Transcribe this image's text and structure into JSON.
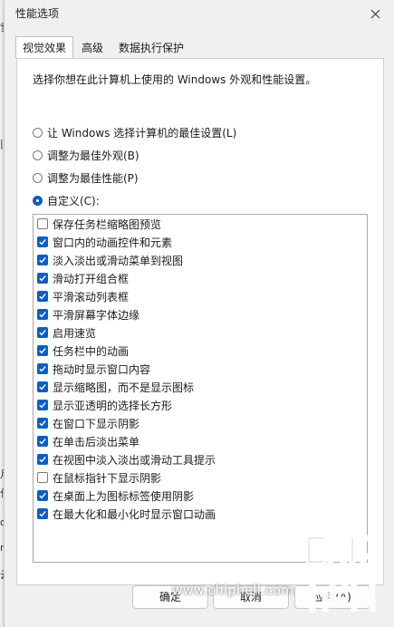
{
  "dialog": {
    "title": "性能选项",
    "close_icon": "close-icon"
  },
  "tabs": [
    {
      "label": "视觉效果",
      "active": true
    },
    {
      "label": "高级",
      "active": false
    },
    {
      "label": "数据执行保护",
      "active": false
    }
  ],
  "panel": {
    "description": "选择你想在此计算机上使用的 Windows 外观和性能设置。",
    "radios": [
      {
        "label": "让 Windows 选择计算机的最佳设置(L)",
        "checked": false
      },
      {
        "label": "调整为最佳外观(B)",
        "checked": false
      },
      {
        "label": "调整为最佳性能(P)",
        "checked": false
      },
      {
        "label": "自定义(C):",
        "checked": true
      }
    ],
    "options": [
      {
        "label": "保存任务栏缩略图预览",
        "checked": false
      },
      {
        "label": "窗口内的动画控件和元素",
        "checked": true
      },
      {
        "label": "淡入淡出或滑动菜单到视图",
        "checked": true
      },
      {
        "label": "滑动打开组合框",
        "checked": true
      },
      {
        "label": "平滑滚动列表框",
        "checked": true
      },
      {
        "label": "平滑屏幕字体边缘",
        "checked": true
      },
      {
        "label": "启用速览",
        "checked": true
      },
      {
        "label": "任务栏中的动画",
        "checked": true
      },
      {
        "label": "拖动时显示窗口内容",
        "checked": true
      },
      {
        "label": "显示缩略图，而不是显示图标",
        "checked": true
      },
      {
        "label": "显示亚透明的选择长方形",
        "checked": true
      },
      {
        "label": "在窗口下显示阴影",
        "checked": true
      },
      {
        "label": "在单击后淡出菜单",
        "checked": true
      },
      {
        "label": "在视图中淡入淡出或滑动工具提示",
        "checked": true
      },
      {
        "label": "在鼠标指针下显示阴影",
        "checked": false
      },
      {
        "label": "在桌面上为图标标签使用阴影",
        "checked": true
      },
      {
        "label": "在最大化和最小化时显示窗口动画",
        "checked": true
      }
    ]
  },
  "buttons": {
    "ok": "确定",
    "cancel": "取消",
    "apply": "应用(A)"
  },
  "watermark": "www.chiphell.com",
  "logo_text": "chiphell",
  "colors": {
    "accent": "#0a5fc2",
    "panel_bg": "#ffffff",
    "dialog_bg": "#f0f0f0"
  }
}
